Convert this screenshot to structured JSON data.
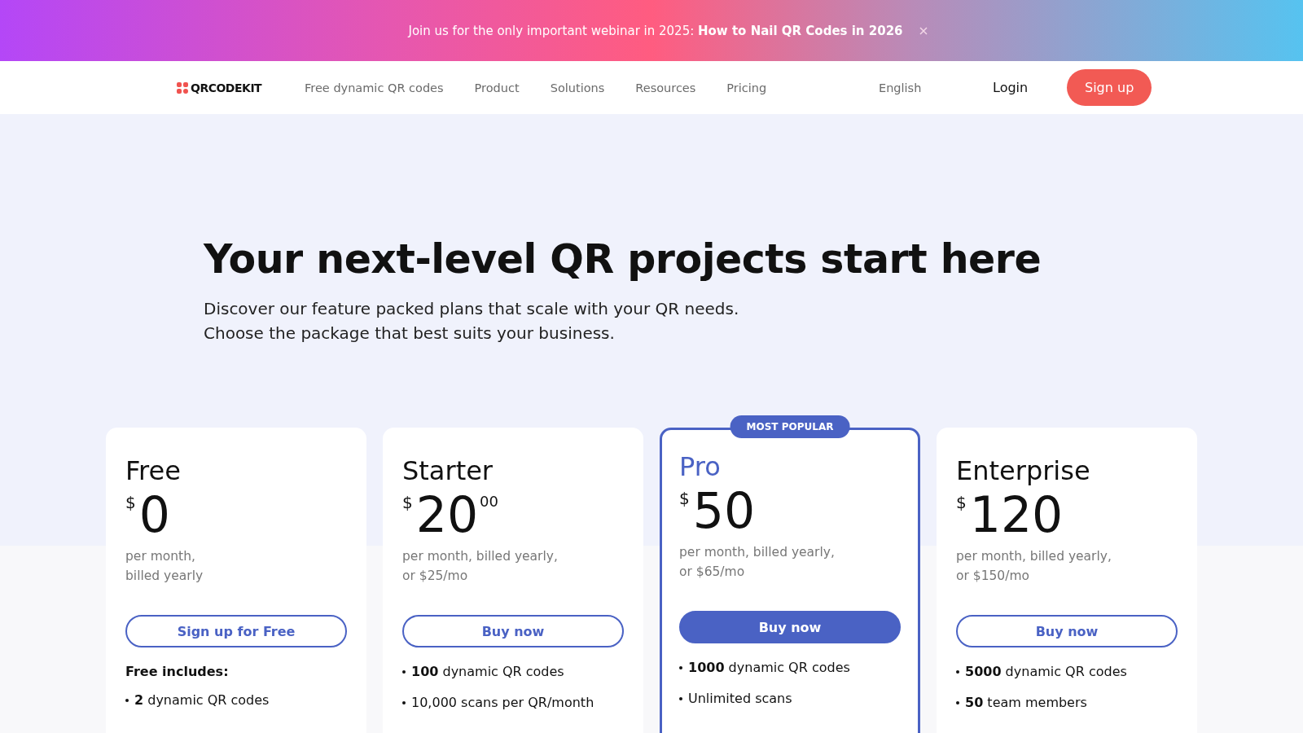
{
  "banner": {
    "text": "Join us for the only important webinar in 2025: **How to Nail QR Codes in 2026**"
  },
  "nav": {
    "logo": "QRCODEKIT",
    "links": [
      "Free dynamic QR codes",
      "Product",
      "Solutions",
      "Resources",
      "Pricing"
    ],
    "language": "English",
    "login": "Login",
    "signup": "Sign up"
  },
  "hero": {
    "title": "Your next-level QR projects start here",
    "subtitle": [
      "Discover our feature packed plans that scale with your QR needs.",
      "Choose the package that best suits your business."
    ]
  },
  "plans": [
    {
      "name": "Free",
      "featured": false,
      "currency": "$",
      "amount": "0",
      "billing": [
        "per month,",
        "billed yearly"
      ],
      "button": "Sign up for Free",
      "includes": "Free includes:",
      "features": [
        "**2** dynamic QR codes"
      ]
    },
    {
      "name": "Starter",
      "featured": false,
      "currency": "$",
      "amount": "20",
      "cents": "00",
      "billing": [
        "per month, billed yearly,",
        "or $25/mo"
      ],
      "button": "Buy now",
      "features": [
        "**100** dynamic QR codes",
        "10,000 scans per QR/month"
      ]
    },
    {
      "name": "Pro",
      "featured": true,
      "badge": "MOST POPULAR",
      "currency": "$",
      "amount": "50",
      "billing": [
        "per month, billed yearly,",
        "or $65/mo"
      ],
      "button": "Buy now",
      "features": [
        "**1000** dynamic QR codes",
        "Unlimited scans"
      ]
    },
    {
      "name": "Enterprise",
      "featured": false,
      "currency": "$",
      "amount": "120",
      "billing": [
        "per month, billed yearly,",
        "or $150/mo"
      ],
      "button": "Buy now",
      "features": [
        "**5000** dynamic QR codes",
        "**50** team members"
      ]
    }
  ]
}
